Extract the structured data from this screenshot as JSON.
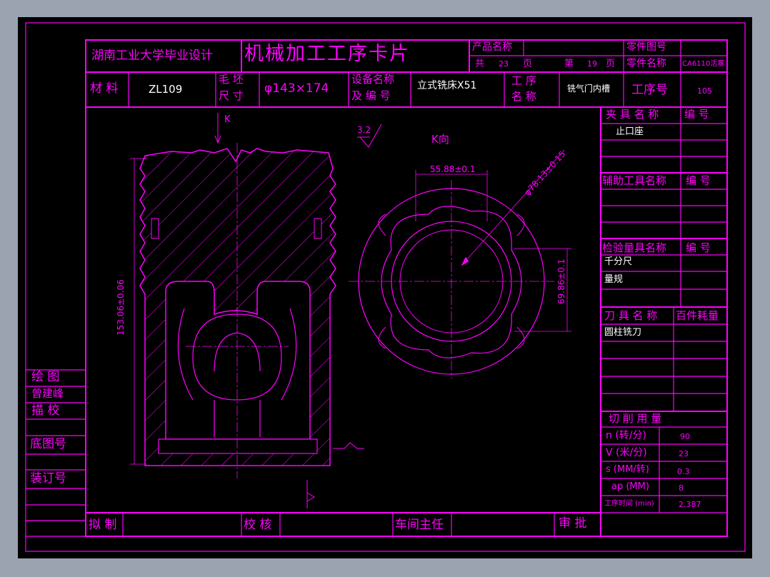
{
  "colors": {
    "line": "#ff00ff",
    "background": "#000000",
    "frame": "#9aa3af",
    "text": "#ffffff"
  },
  "header": {
    "school": "湖南工业大学毕业设计",
    "card_title": "机械加工工序卡片",
    "product_name_label": "产品名称",
    "part_drawing_no_label": "零件图号",
    "total_label": "共",
    "total_pages": "23",
    "page_unit_1": "页",
    "page_label": "第",
    "page_no": "19",
    "page_unit_2": "页",
    "part_name_label": "零件名称",
    "part_name": "CA6110活塞"
  },
  "row2": {
    "material_label": "材 料",
    "material": "ZL109",
    "blank_label_1": "毛 坯",
    "blank_label_2": "尺 寸",
    "blank_size": "φ143×174",
    "equipment_label_1": "设备名称",
    "equipment_label_2": "及 编 号",
    "equipment": "立式铣床X51",
    "process_label_1": "工  序",
    "process_label_2": "名  称",
    "process_name": "铣气门内槽",
    "process_no_label": "工序号",
    "process_no": "105"
  },
  "right_panel": {
    "fixture_header": "夹 具 名 称",
    "fixture_no_header": "编  号",
    "fixture_item": "止口座",
    "aux_header": "辅助工具名称",
    "aux_no_header": "编  号",
    "gauge_header": "检验量具名称",
    "gauge_no_header": "编  号",
    "gauge_items": [
      "千分尺",
      "量规"
    ],
    "tool_header": "刀 具 名 称",
    "tool_consume_header": "百件耗量",
    "tool_item": "圆柱铣刀",
    "cutting_header": "切  削  用  量",
    "cutting_rows": [
      {
        "label": "n (转/分)",
        "value": "90"
      },
      {
        "label": "V (米/分)",
        "value": "23"
      },
      {
        "label": "s (MM/转)",
        "value": "0.3"
      },
      {
        "label": "ap (MM)",
        "value": "8"
      },
      {
        "label": "工序时间 (min)",
        "value": "2.387"
      }
    ]
  },
  "left_column": {
    "drawing_label": "绘  图",
    "drawer": "曾建峰",
    "tracing_label": "描  校",
    "base_drawing_no": "底图号",
    "binding_no": "装订号"
  },
  "bottom_row": {
    "draft_label": "拟 制",
    "check_label": "校 核",
    "workshop_label": "车间主任",
    "approve_label": "审 批"
  },
  "drawing": {
    "view_arrow_label": "K",
    "view_title": "K向",
    "roughness": "3.2",
    "dim_height": "153.06±0.06",
    "dim_width_top": "55.88±0.1",
    "dim_diameter": "φ78.13±0.15",
    "dim_width_side": "69.86±0.1"
  }
}
